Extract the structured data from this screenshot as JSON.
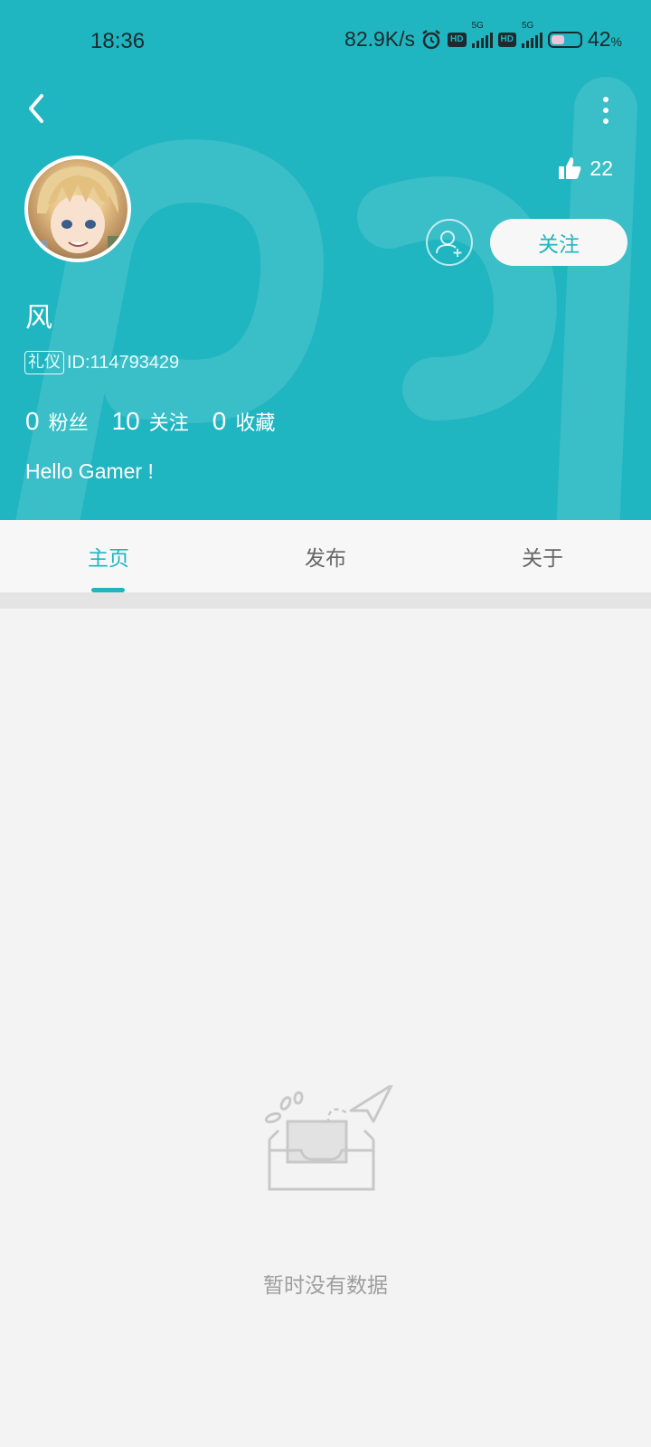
{
  "status_bar": {
    "time": "18:36",
    "speed": "82.9K/s",
    "hd1": "HD",
    "net1": "5G",
    "hd2": "HD",
    "net2": "5G",
    "battery_percent": "42",
    "battery_unit": "%"
  },
  "header": {
    "back_icon": "chevron-left-icon",
    "more_icon": "more-vertical-icon",
    "likes": "22",
    "follow_label": "关注"
  },
  "profile": {
    "username": "风",
    "badge": "礼仪",
    "id_text": "ID:114793429",
    "bio": "Hello Gamer !",
    "stats": [
      {
        "value": "0",
        "label": "粉丝"
      },
      {
        "value": "10",
        "label": "关注"
      },
      {
        "value": "0",
        "label": "收藏"
      }
    ]
  },
  "tabs": [
    {
      "label": "主页",
      "active": true
    },
    {
      "label": "发布",
      "active": false
    },
    {
      "label": "关于",
      "active": false
    }
  ],
  "empty_state": {
    "text": "暂时没有数据"
  },
  "colors": {
    "accent": "#1fb5c1",
    "background": "#f3f3f3"
  }
}
